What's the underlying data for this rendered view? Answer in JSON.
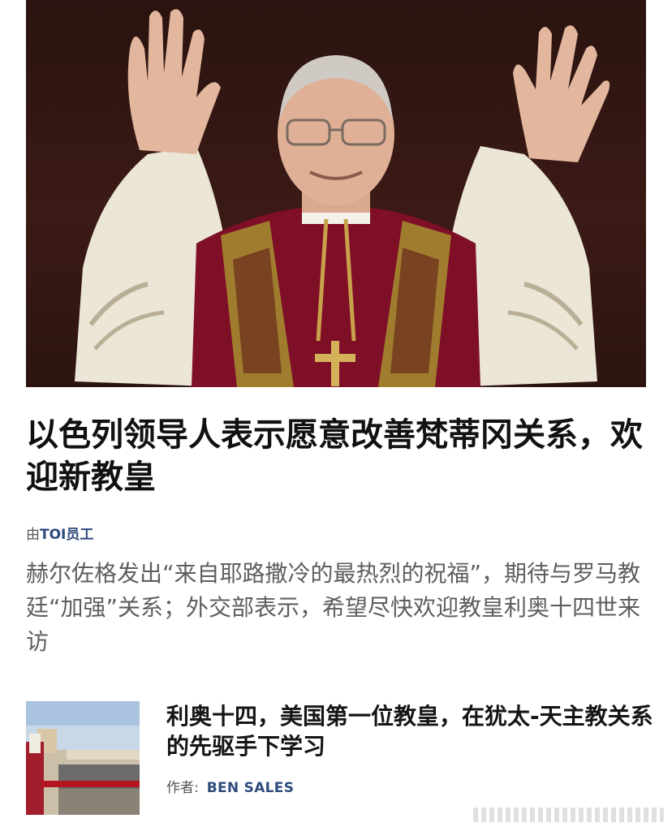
{
  "article": {
    "headline": "以色列领导人表示愿意改善梵蒂冈关系，欢迎新教皇",
    "byline_prefix": "由",
    "byline_author": "TOI员工",
    "summary": "赫尔佐格发出“来自耶路撒冷的最热烈的祝福”，期待与罗马教廷“加强”关系；外交部表示，希望尽快欢迎教皇利奥十四世来访"
  },
  "related": {
    "title": "利奥十四，美国第一位教皇，在犹太-天主教关系的先驱手下学习",
    "byline_prefix": "作者:",
    "byline_author": "BEN SALES"
  },
  "colors": {
    "author_link": "#2e4a7d",
    "summary_text": "#5e5e5e",
    "hero_background": "#2a1310"
  }
}
